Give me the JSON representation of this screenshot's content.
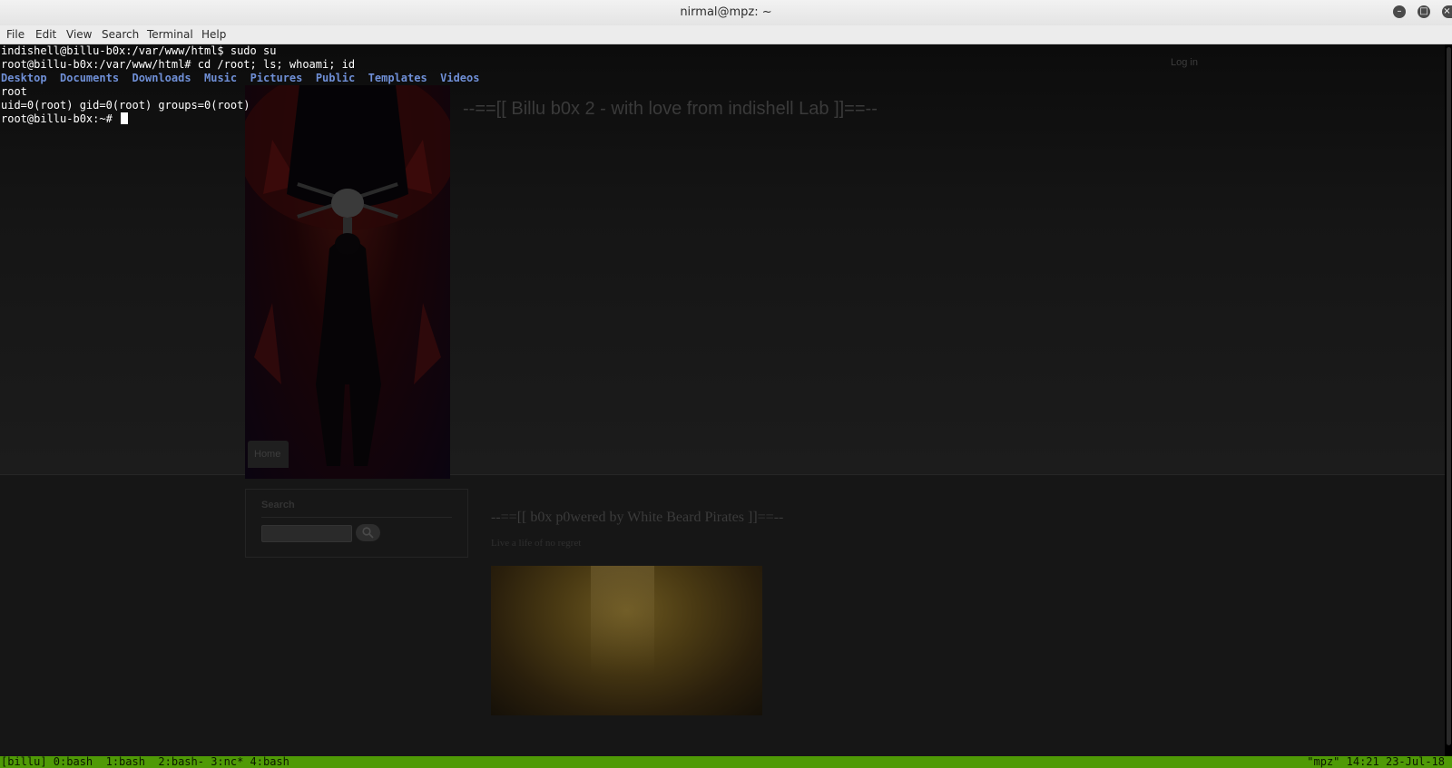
{
  "window": {
    "title": "nirmal@mpz: ~",
    "minimize_label": "–",
    "maximize_label": "□",
    "close_label": "×"
  },
  "menu": [
    "File",
    "Edit",
    "View",
    "Search",
    "Terminal",
    "Help"
  ],
  "terminal": {
    "lines": [
      "indishell@billu-b0x:/var/www/html$ sudo su",
      "root@billu-b0x:/var/www/html# cd /root; ls; whoami; id"
    ],
    "ls_dirs": [
      "Desktop",
      "Documents",
      "Downloads",
      "Music",
      "Pictures",
      "Public",
      "Templates",
      "Videos"
    ],
    "whoami_output": "root",
    "id_output": "uid=0(root) gid=0(root) groups=0(root)",
    "prompt": "root@billu-b0x:~# "
  },
  "webpage": {
    "login_link": "Log in",
    "site_title": "--==[[ Billu b0x 2 - with love from indishell Lab ]]==--",
    "nav_home": "Home",
    "search_label": "Search",
    "post_title": "--==[[ b0x p0wered by White Beard Pirates ]]==--",
    "post_subtitle": "Live a life of no regret"
  },
  "tmux": {
    "left": "[billu] 0:bash  1:bash  2:bash- 3:nc* 4:bash",
    "right": "\"mpz\" 14:21 23-Jul-18",
    "color": "#4f9a06"
  },
  "colors": {
    "directory": "#6f8fd6",
    "terminal_bg": "#000000",
    "terminal_fg": "#ffffff"
  }
}
